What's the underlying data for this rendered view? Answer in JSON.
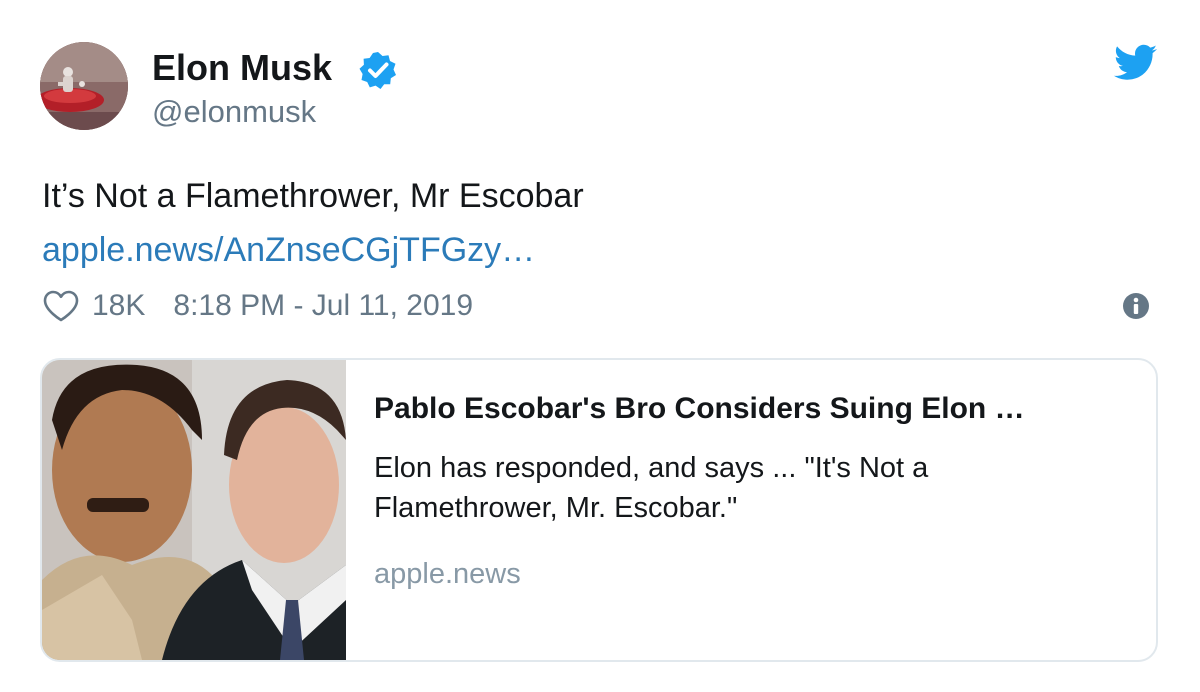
{
  "author": {
    "name": "Elon Musk",
    "handle": "@elonmusk",
    "verified_icon": "verified-badge-icon",
    "avatar_icon": "avatar-image"
  },
  "tweet": {
    "text": "It’s Not a Flamethrower, Mr Escobar",
    "link": "apple.news/AnZnseCGjTFGzy…",
    "likes": "18K",
    "timestamp": "8:18 PM - Jul 11, 2019"
  },
  "card": {
    "title": "Pablo Escobar's Bro Considers Suing Elon …",
    "description": "Elon has responded, and says ... \"It's Not a Flamethrower, Mr. Escobar.\"",
    "domain": "apple.news"
  },
  "colors": {
    "link": "#2b7bb9",
    "twitter_blue": "#1da1f2",
    "muted": "#657786",
    "border": "#e1e8ed"
  }
}
